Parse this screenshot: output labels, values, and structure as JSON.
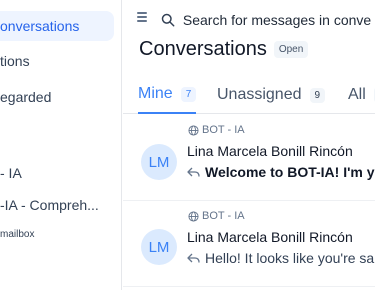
{
  "sidebar": {
    "items": [
      {
        "label": "onversations",
        "active": true
      },
      {
        "label": "tions"
      },
      {
        "label": "egarded"
      },
      {
        "label": "- IA"
      },
      {
        "label": "-IA - Compreh..."
      }
    ],
    "footer_label": "mailbox"
  },
  "header": {
    "search_placeholder": "Search for messages in conve",
    "title": "Conversations",
    "status": "Open"
  },
  "tabs": [
    {
      "label": "Mine",
      "count": "7",
      "active": true
    },
    {
      "label": "Unassigned",
      "count": "9"
    },
    {
      "label": "All",
      "count": ""
    }
  ],
  "conversations": [
    {
      "inbox": "BOT - IA",
      "avatar_initials": "LM",
      "name": "Lina Marcela Bonill Rincón",
      "message": "Welcome to BOT-IA! I'm y",
      "unread": true
    },
    {
      "inbox": "BOT - IA",
      "avatar_initials": "LM",
      "name": "Lina Marcela Bonill Rincón",
      "message": "Hello! It looks like you're sa",
      "unread": false
    }
  ],
  "colors": {
    "accent": "#3b82f6",
    "active_bg": "#eef4ff",
    "avatar_bg": "#dbeafe"
  },
  "icons": [
    "menu-icon",
    "search-icon",
    "globe-icon",
    "reply-icon"
  ]
}
